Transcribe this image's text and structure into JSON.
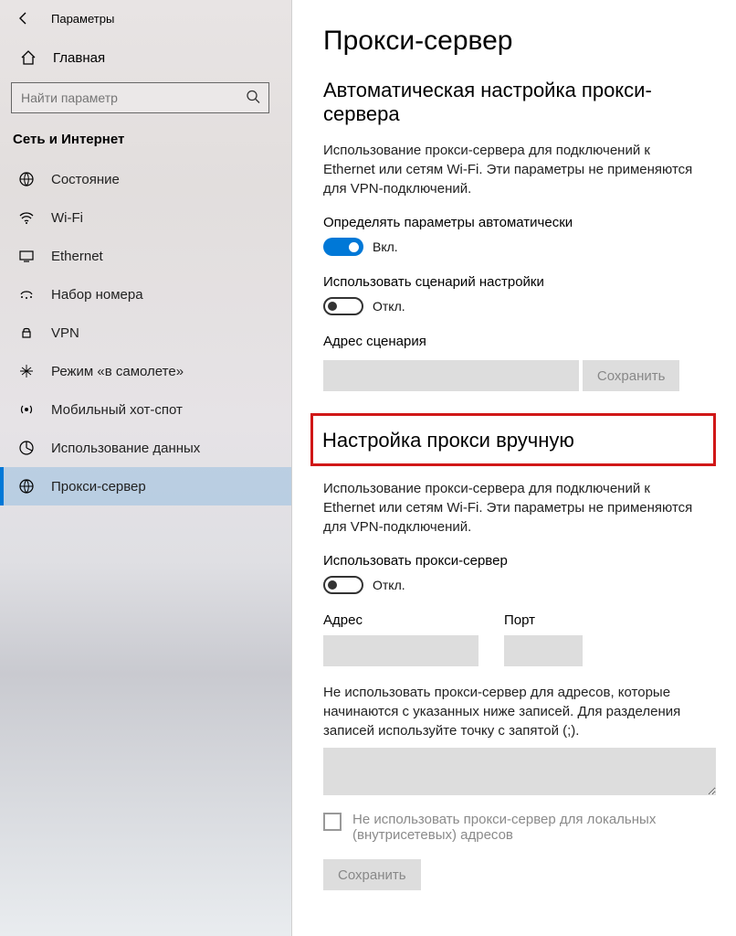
{
  "header": {
    "app_title": "Параметры"
  },
  "sidebar": {
    "home_label": "Главная",
    "search_placeholder": "Найти параметр",
    "category": "Сеть и Интернет",
    "items": [
      {
        "label": "Состояние"
      },
      {
        "label": "Wi-Fi"
      },
      {
        "label": "Ethernet"
      },
      {
        "label": "Набор номера"
      },
      {
        "label": "VPN"
      },
      {
        "label": "Режим «в самолете»"
      },
      {
        "label": "Мобильный хот-спот"
      },
      {
        "label": "Использование данных"
      },
      {
        "label": "Прокси-сервер"
      }
    ]
  },
  "main": {
    "page_title": "Прокси-сервер",
    "auto": {
      "title": "Автоматическая настройка прокси-сервера",
      "desc": "Использование прокси-сервера для подключений к Ethernet или сетям Wi-Fi. Эти параметры не применяются для VPN-подключений.",
      "detect_label": "Определять параметры автоматически",
      "detect_state": "Вкл.",
      "script_label": "Использовать сценарий настройки",
      "script_state": "Откл.",
      "script_addr_label": "Адрес сценария",
      "save_label": "Сохранить"
    },
    "manual": {
      "title": "Настройка прокси вручную",
      "desc": "Использование прокси-сервера для подключений к Ethernet или сетям Wi-Fi. Эти параметры не применяются для VPN-подключений.",
      "use_label": "Использовать прокси-сервер",
      "use_state": "Откл.",
      "addr_label": "Адрес",
      "port_label": "Порт",
      "exceptions_text": "Не использовать прокси-сервер для адресов, которые начинаются с указанных ниже записей. Для разделения записей используйте точку с запятой (;).",
      "local_checkbox": "Не использовать прокси-сервер для локальных (внутрисетевых) адресов",
      "save_label": "Сохранить"
    }
  }
}
